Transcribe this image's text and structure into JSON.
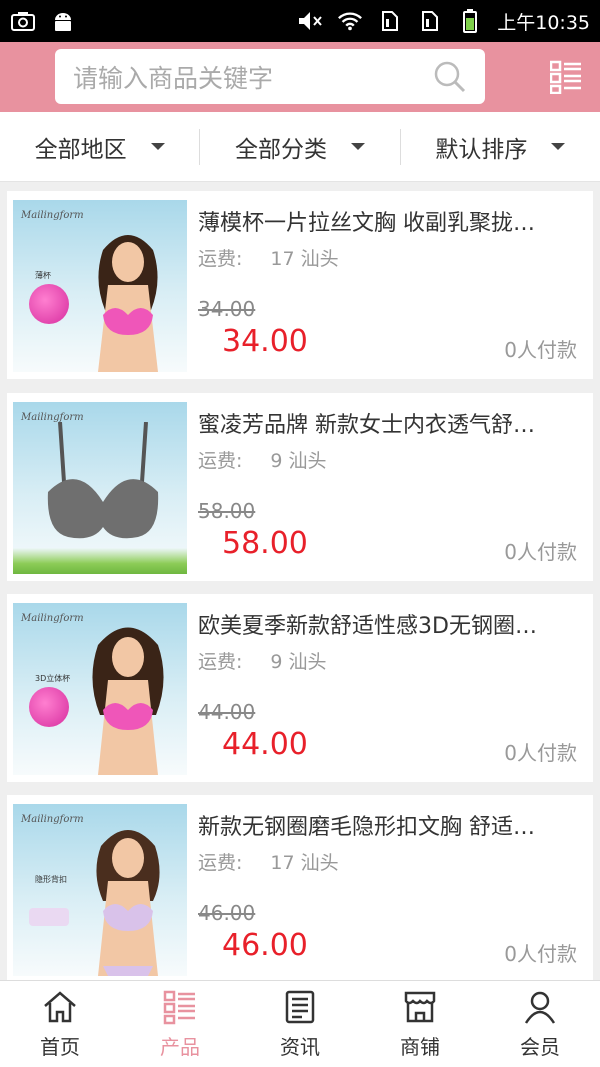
{
  "status_bar": {
    "time": "上午10:35",
    "icons": [
      "camera-icon",
      "android-icon",
      "mute-icon",
      "wifi-icon",
      "sim1-icon",
      "sim2-icon",
      "battery-icon"
    ]
  },
  "header": {
    "search_placeholder": "请输入商品关键字",
    "menu_icon": "list-menu-icon",
    "bg_color": "#e8929f"
  },
  "filters": [
    {
      "label": "全部地区"
    },
    {
      "label": "全部分类"
    },
    {
      "label": "默认排序"
    }
  ],
  "products": [
    {
      "title": "薄模杯一片拉丝文胸 收副乳聚拢…",
      "ship_label": "运费:",
      "ship_value": "17 汕头",
      "old_price": "34.00",
      "price": "34.00",
      "payers": "0人付款",
      "brand": "Mailingform",
      "inset": "薄杯"
    },
    {
      "title": "蜜凌芳品牌 新款女士内衣透气舒…",
      "ship_label": "运费:",
      "ship_value": "9 汕头",
      "old_price": "58.00",
      "price": "58.00",
      "payers": "0人付款",
      "brand": "Mailingform",
      "inset": ""
    },
    {
      "title": "欧美夏季新款舒适性感3D无钢圈…",
      "ship_label": "运费:",
      "ship_value": "9 汕头",
      "old_price": "44.00",
      "price": "44.00",
      "payers": "0人付款",
      "brand": "Mailingform",
      "inset": "3D立体杯"
    },
    {
      "title": "新款无钢圈磨毛隐形扣文胸 舒适…",
      "ship_label": "运费:",
      "ship_value": "17 汕头",
      "old_price": "46.00",
      "price": "46.00",
      "payers": "0人付款",
      "brand": "Mailingform",
      "inset": "隐形背扣"
    }
  ],
  "bottom_nav": [
    {
      "label": "首页",
      "icon": "home-icon"
    },
    {
      "label": "产品",
      "icon": "product-list-icon",
      "active": true
    },
    {
      "label": "资讯",
      "icon": "news-icon"
    },
    {
      "label": "商铺",
      "icon": "shop-icon"
    },
    {
      "label": "会员",
      "icon": "member-icon"
    }
  ],
  "colors": {
    "accent": "#e8929f",
    "price_red": "#e8202a"
  }
}
